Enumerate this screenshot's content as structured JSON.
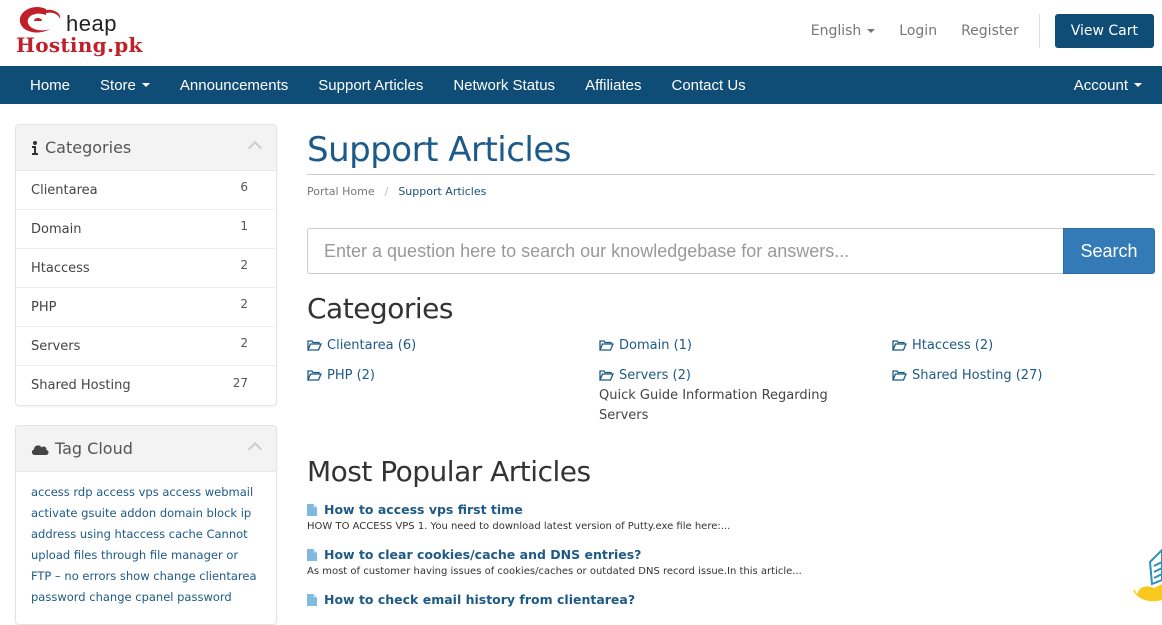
{
  "brand": {
    "logo_top": "heap",
    "logo_bottom": "Hosting.pk",
    "colors": {
      "brand_red": "#c0202a",
      "nav_blue": "#0f4d77",
      "link_blue": "#1d5a85",
      "search_blue": "#337ab7"
    }
  },
  "header": {
    "language": "English",
    "login": "Login",
    "register": "Register",
    "view_cart": "View Cart"
  },
  "nav": {
    "items": [
      {
        "label": "Home"
      },
      {
        "label": "Store",
        "dropdown": true
      },
      {
        "label": "Announcements"
      },
      {
        "label": "Support Articles"
      },
      {
        "label": "Network Status"
      },
      {
        "label": "Affiliates"
      },
      {
        "label": "Contact Us"
      }
    ],
    "account": "Account"
  },
  "sidebar": {
    "categories_title": "Categories",
    "categories": [
      {
        "name": "Clientarea",
        "count": "6"
      },
      {
        "name": "Domain",
        "count": "1"
      },
      {
        "name": "Htaccess",
        "count": "2"
      },
      {
        "name": "PHP",
        "count": "2"
      },
      {
        "name": "Servers",
        "count": "2"
      },
      {
        "name": "Shared Hosting",
        "count": "27"
      }
    ],
    "tagcloud_title": "Tag Cloud",
    "tags": [
      "access rdp",
      "access vps",
      "access webmail",
      "activate gsuite",
      "addon domain",
      "block ip address using htaccess",
      "cache",
      "Cannot upload files through file manager or FTP – no errors show",
      "change clientarea password",
      "change cpanel password"
    ]
  },
  "main": {
    "title": "Support Articles",
    "breadcrumb": {
      "home": "Portal Home",
      "separator": "/",
      "current": "Support Articles"
    },
    "search": {
      "placeholder": "Enter a question here to search our knowledgebase for answers...",
      "button": "Search"
    },
    "categories_heading": "Categories",
    "categories": [
      {
        "label": "Clientarea (6)"
      },
      {
        "label": "Domain (1)"
      },
      {
        "label": "Htaccess (2)"
      },
      {
        "label": "PHP (2)"
      },
      {
        "label": "Servers (2)",
        "description": "Quick Guide Information Regarding Servers"
      },
      {
        "label": "Shared Hosting (27)"
      }
    ],
    "popular_heading": "Most Popular Articles",
    "articles": [
      {
        "title": "How to access vps first time",
        "snippet": "HOW TO ACCESS VPS 1.   You need to download latest version of Putty.exe file here:..."
      },
      {
        "title": "How to clear cookies/cache and DNS entries?",
        "snippet": "As most of customer having issues of cookies/caches or outdated DNS record issue.In this article..."
      },
      {
        "title": "How to check email history from clientarea?",
        "snippet": ""
      }
    ]
  }
}
